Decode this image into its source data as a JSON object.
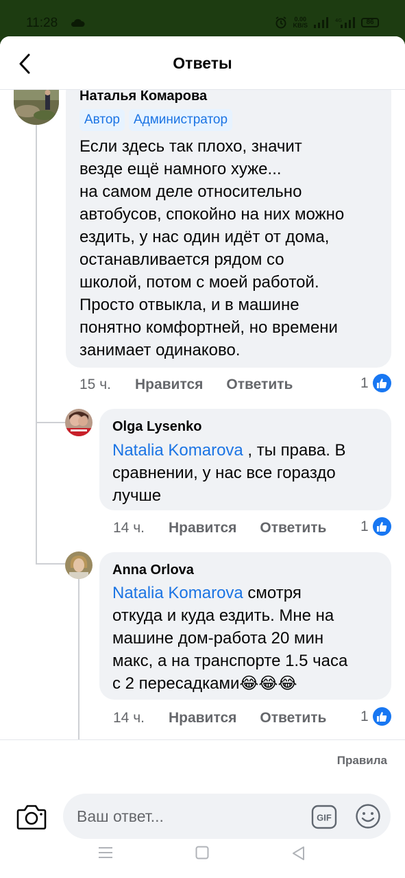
{
  "status_bar": {
    "time": "11:28",
    "net_speed_value": "0.00",
    "net_speed_unit": "KB/S",
    "battery": "86"
  },
  "header": {
    "title": "Ответы"
  },
  "comments": [
    {
      "author": "Наталья Комарова",
      "badges": [
        "Автор",
        "Администратор"
      ],
      "text_lines": [
        "Если здесь так плохо, значит",
        "везде ещё намного хуже...",
        "на самом деле относительно",
        "автобусов, спокойно на них можно",
        "ездить, у нас один идёт от дома,",
        "останавливается рядом со",
        "школой, потом с моей работой.",
        "Просто отвыкла, и в машине",
        "понятно комфортней, но времени",
        "занимает одинаково."
      ],
      "time": "15 ч.",
      "like_label": "Нравится",
      "reply_label": "Ответить",
      "reactions": "1"
    },
    {
      "author": "Olga Lysenko",
      "mention": "Natalia Komarova",
      "text_line1_rest": " , ты права. В",
      "text_lines": [
        "сравнении, у нас все гораздо",
        "лучше"
      ],
      "time": "14 ч.",
      "like_label": "Нравится",
      "reply_label": "Ответить",
      "reactions": "1"
    },
    {
      "author": "Anna Orlova",
      "mention": "Natalia Komarova",
      "text_line1_rest": " смотря",
      "text_lines": [
        "откуда и куда ездить. Мне на",
        "машине дом-работа 20 мин",
        "макс, а на транспорте 1.5 часа",
        "с 2 пересадками"
      ],
      "emojis": "😂😂😂",
      "time": "14 ч.",
      "like_label": "Нравится",
      "reply_label": "Ответить",
      "reactions": "1"
    }
  ],
  "composer": {
    "rules_label": "Правила",
    "placeholder": "Ваш ответ...",
    "gif_label": "GIF"
  },
  "colors": {
    "accent": "#1b74e4",
    "like_blue": "#1877f2",
    "bubble_bg": "#f0f2f5",
    "secondary_text": "#65676b",
    "status_bar_bg": "#1d3c11"
  }
}
